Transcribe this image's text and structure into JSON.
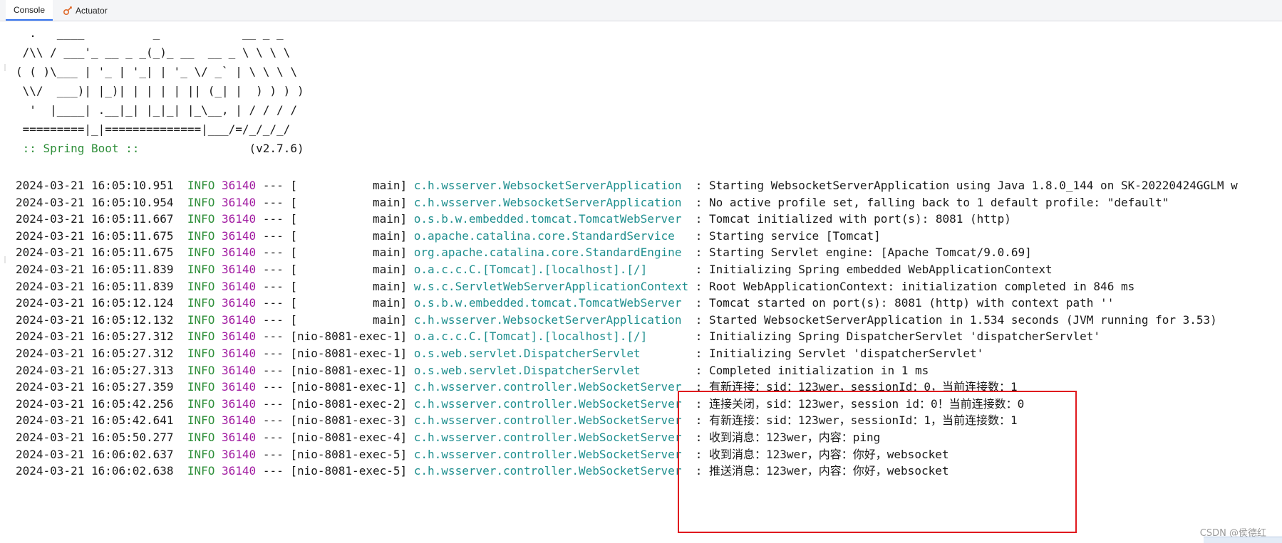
{
  "tabs": [
    {
      "label": "Console",
      "active": true
    },
    {
      "label": "Actuator",
      "active": false
    }
  ],
  "banner": [
    "  .   ____          _            __ _ _",
    " /\\\\ / ___'_ __ _ _(_)_ __  __ _ \\ \\ \\ \\",
    "( ( )\\___ | '_ | '_| | '_ \\/ _` | \\ \\ \\ \\",
    " \\\\/  ___)| |_)| | | | | || (_| |  ) ) ) )",
    "  '  |____| .__|_| |_|_| |_\\__, | / / / /",
    " =========|_|==============|___/=/_/_/_/"
  ],
  "spring_boot_label": " :: Spring Boot :: ",
  "spring_boot_version": "               (v2.7.6)",
  "log_lines": [
    {
      "ts": "2024-03-21 16:05:10.951",
      "level": "INFO",
      "pid": "36140",
      "thread": "           main",
      "logger": "c.h.wsserver.WebsocketServerApplication  ",
      "msg": "Starting WebsocketServerApplication using Java 1.8.0_144 on SK-20220424GGLM w"
    },
    {
      "ts": "2024-03-21 16:05:10.954",
      "level": "INFO",
      "pid": "36140",
      "thread": "           main",
      "logger": "c.h.wsserver.WebsocketServerApplication  ",
      "msg": "No active profile set, falling back to 1 default profile: \"default\""
    },
    {
      "ts": "2024-03-21 16:05:11.667",
      "level": "INFO",
      "pid": "36140",
      "thread": "           main",
      "logger": "o.s.b.w.embedded.tomcat.TomcatWebServer  ",
      "msg": "Tomcat initialized with port(s): 8081 (http)"
    },
    {
      "ts": "2024-03-21 16:05:11.675",
      "level": "INFO",
      "pid": "36140",
      "thread": "           main",
      "logger": "o.apache.catalina.core.StandardService   ",
      "msg": "Starting service [Tomcat]"
    },
    {
      "ts": "2024-03-21 16:05:11.675",
      "level": "INFO",
      "pid": "36140",
      "thread": "           main",
      "logger": "org.apache.catalina.core.StandardEngine  ",
      "msg": "Starting Servlet engine: [Apache Tomcat/9.0.69]"
    },
    {
      "ts": "2024-03-21 16:05:11.839",
      "level": "INFO",
      "pid": "36140",
      "thread": "           main",
      "logger": "o.a.c.c.C.[Tomcat].[localhost].[/]       ",
      "msg": "Initializing Spring embedded WebApplicationContext"
    },
    {
      "ts": "2024-03-21 16:05:11.839",
      "level": "INFO",
      "pid": "36140",
      "thread": "           main",
      "logger": "w.s.c.ServletWebServerApplicationContext ",
      "msg": "Root WebApplicationContext: initialization completed in 846 ms"
    },
    {
      "ts": "2024-03-21 16:05:12.124",
      "level": "INFO",
      "pid": "36140",
      "thread": "           main",
      "logger": "o.s.b.w.embedded.tomcat.TomcatWebServer  ",
      "msg": "Tomcat started on port(s): 8081 (http) with context path ''"
    },
    {
      "ts": "2024-03-21 16:05:12.132",
      "level": "INFO",
      "pid": "36140",
      "thread": "           main",
      "logger": "c.h.wsserver.WebsocketServerApplication  ",
      "msg": "Started WebsocketServerApplication in 1.534 seconds (JVM running for 3.53)"
    },
    {
      "ts": "2024-03-21 16:05:27.312",
      "level": "INFO",
      "pid": "36140",
      "thread": "nio-8081-exec-1",
      "logger": "o.a.c.c.C.[Tomcat].[localhost].[/]       ",
      "msg": "Initializing Spring DispatcherServlet 'dispatcherServlet'"
    },
    {
      "ts": "2024-03-21 16:05:27.312",
      "level": "INFO",
      "pid": "36140",
      "thread": "nio-8081-exec-1",
      "logger": "o.s.web.servlet.DispatcherServlet        ",
      "msg": "Initializing Servlet 'dispatcherServlet'"
    },
    {
      "ts": "2024-03-21 16:05:27.313",
      "level": "INFO",
      "pid": "36140",
      "thread": "nio-8081-exec-1",
      "logger": "o.s.web.servlet.DispatcherServlet        ",
      "msg": "Completed initialization in 1 ms"
    },
    {
      "ts": "2024-03-21 16:05:27.359",
      "level": "INFO",
      "pid": "36140",
      "thread": "nio-8081-exec-1",
      "logger": "c.h.wsserver.controller.WebSocketServer  ",
      "msg": "有新连接：sid：123wer，sessionId：0，当前连接数：1"
    },
    {
      "ts": "2024-03-21 16:05:42.256",
      "level": "INFO",
      "pid": "36140",
      "thread": "nio-8081-exec-2",
      "logger": "c.h.wsserver.controller.WebSocketServer  ",
      "msg": "连接关闭，sid：123wer，session id：0！当前连接数：0"
    },
    {
      "ts": "2024-03-21 16:05:42.641",
      "level": "INFO",
      "pid": "36140",
      "thread": "nio-8081-exec-3",
      "logger": "c.h.wsserver.controller.WebSocketServer  ",
      "msg": "有新连接：sid：123wer，sessionId：1，当前连接数：1"
    },
    {
      "ts": "2024-03-21 16:05:50.277",
      "level": "INFO",
      "pid": "36140",
      "thread": "nio-8081-exec-4",
      "logger": "c.h.wsserver.controller.WebSocketServer  ",
      "msg": "收到消息：123wer，内容：ping"
    },
    {
      "ts": "2024-03-21 16:06:02.637",
      "level": "INFO",
      "pid": "36140",
      "thread": "nio-8081-exec-5",
      "logger": "c.h.wsserver.controller.WebSocketServer  ",
      "msg": "收到消息：123wer，内容：你好，websocket"
    },
    {
      "ts": "2024-03-21 16:06:02.638",
      "level": "INFO",
      "pid": "36140",
      "thread": "nio-8081-exec-5",
      "logger": "c.h.wsserver.controller.WebSocketServer  ",
      "msg": "推送消息：123wer，内容：你好，websocket"
    }
  ],
  "watermark": "CSDN @侯德红",
  "colors": {
    "info": "#2f8f3a",
    "pid": "#a018a0",
    "logger": "#1f8f8f",
    "highlight": "#e0191e",
    "tab_accent": "#3574f0"
  },
  "icons": {
    "actuator_tab": "actuator-icon"
  }
}
